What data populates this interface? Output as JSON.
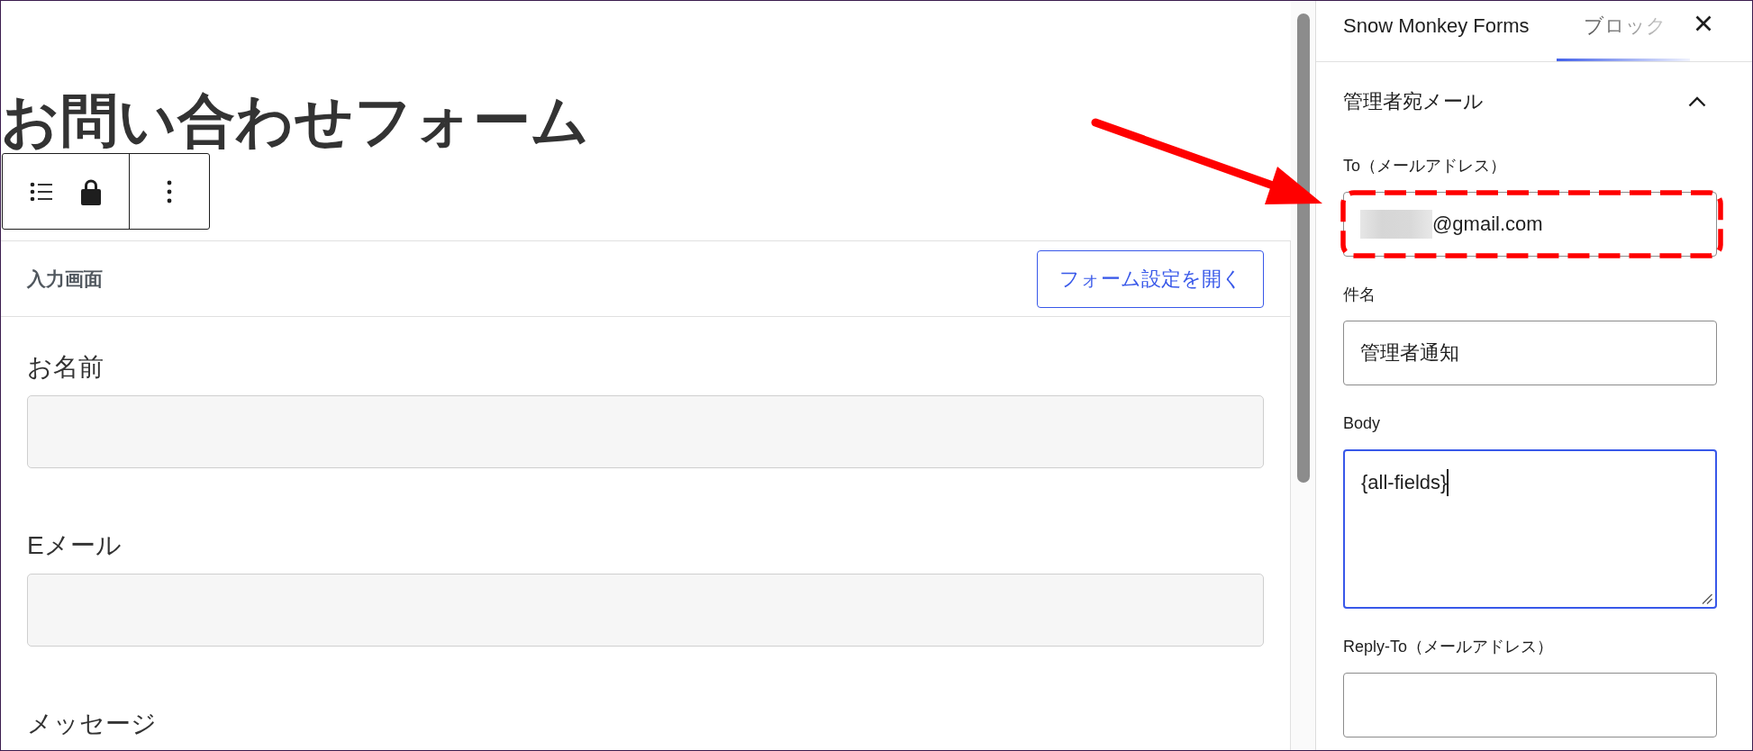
{
  "editor": {
    "title": "お問い合わせフォーム",
    "block_toolbar": {
      "groups": [
        {
          "buttons": [
            {
              "kind": "list-view"
            },
            {
              "kind": "lock"
            }
          ]
        },
        {
          "buttons": [
            {
              "kind": "options"
            }
          ]
        }
      ]
    },
    "form_block": {
      "header": {
        "title": "入力画面",
        "button": "フォーム設定を開く"
      },
      "fields": [
        {
          "label": "お名前",
          "kind": "input"
        },
        {
          "label": "Eメール",
          "kind": "input"
        },
        {
          "label": "メッセージ",
          "kind": "label"
        }
      ]
    }
  },
  "sidebar": {
    "tabs": [
      {
        "label": "Snow Monkey Forms",
        "selected": false
      },
      {
        "label": "ブロック",
        "selected": true
      }
    ],
    "section": {
      "title": "管理者宛メール",
      "expanded": true,
      "fields": [
        {
          "label": "To（メールアドレス）",
          "kind": "input",
          "value": "@gmail.com",
          "redacted": true,
          "highlighted": true,
          "focused": false
        },
        {
          "label": "件名",
          "kind": "input",
          "value": "管理者通知",
          "redacted": false,
          "highlighted": false,
          "focused": false
        },
        {
          "label": "Body",
          "kind": "textarea",
          "value": "{all-fields}",
          "redacted": false,
          "highlighted": false,
          "focused": true
        },
        {
          "label": "Reply-To（メールアドレス）",
          "kind": "input",
          "redacted": false,
          "highlighted": false,
          "focused": false
        }
      ]
    }
  },
  "annotations": [
    {
      "kind": "arrow"
    }
  ]
}
